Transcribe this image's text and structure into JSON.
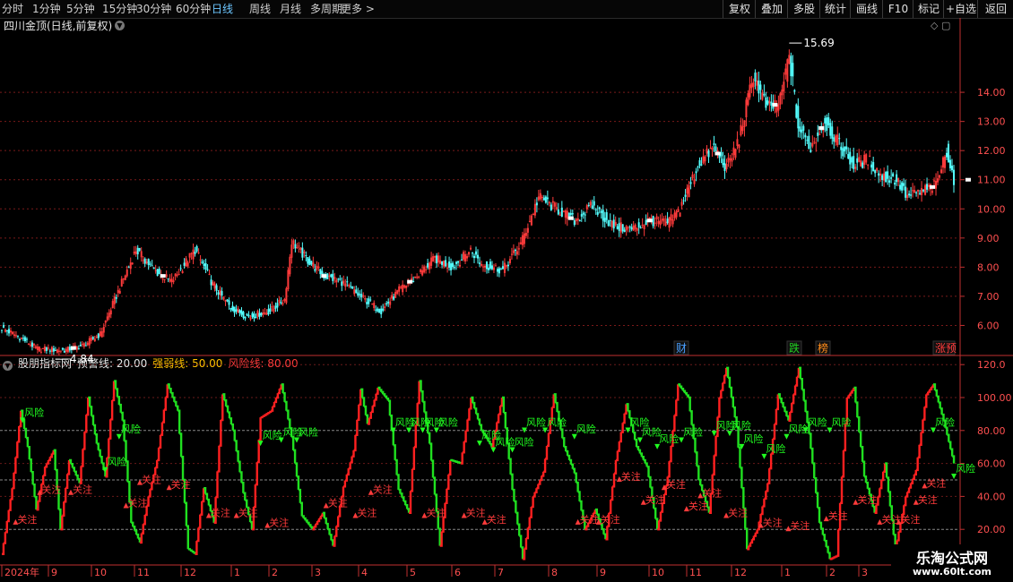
{
  "toolbar": {
    "periods": [
      {
        "label": "分时",
        "active": false
      },
      {
        "label": "1分钟",
        "active": false
      },
      {
        "label": "5分钟",
        "active": false
      },
      {
        "label": "15分钟",
        "active": false
      },
      {
        "label": "30分钟",
        "active": false
      },
      {
        "label": "60分钟",
        "active": false
      },
      {
        "label": "日线",
        "active": true
      },
      {
        "label": "周线",
        "active": false
      },
      {
        "label": "月线",
        "active": false
      },
      {
        "label": "多周期",
        "active": false
      },
      {
        "label": "更多 >",
        "active": false
      }
    ],
    "right_buttons": [
      "复权",
      "叠加",
      "多股",
      "统计",
      "画线",
      "F10",
      "标记",
      "+自选",
      "返回"
    ]
  },
  "stock_title": "四川金顶(日线,前复权)",
  "corner_tools": "◇ ▢",
  "indicator_header": {
    "name": "股朋指标网",
    "warn": "预警线: 20.00",
    "strong": "强弱线: 50.00",
    "risk": "风险线: 80.00"
  },
  "watermark": {
    "line1": "乐淘公式网",
    "line2": "www.60lt.com"
  },
  "colors": {
    "up": "#ff3b3b",
    "down": "#54ffff",
    "bg": "#000000",
    "axis": "#c03030",
    "ind_up": "#ff2020",
    "ind_down": "#20e020",
    "risk_label": "#20ff20",
    "attention_label": "#ff3b3b",
    "warn_text": "#ffff55",
    "strong_text": "#ff8c1a",
    "risk_text": "#ff3b3b"
  },
  "chart_data": [
    {
      "type": "candlestick",
      "title": "四川金顶(日线,前复权)",
      "ylim": [
        5.0,
        16.0
      ],
      "y_ticks": [
        6.0,
        7.0,
        8.0,
        9.0,
        10.0,
        11.0,
        12.0,
        13.0,
        14.0
      ],
      "y_tick_labels": [
        "6.00",
        "7.00",
        "8.00",
        "9.00",
        "10.00",
        "11.00",
        "12.00",
        "13.00",
        "14.00"
      ],
      "annotations": [
        {
          "text": "15.69",
          "price": 15.69
        },
        {
          "text": "4.84",
          "price": 4.84
        }
      ],
      "event_badges": [
        {
          "text": "财",
          "color": "#4aa0ff"
        },
        {
          "text": "跌",
          "color": "#20d020"
        },
        {
          "text": "榜",
          "color": "#ff8c1a"
        },
        {
          "text": "涨预",
          "color": "#ff3b3b"
        }
      ],
      "close_path": [
        [
          0,
          5.9
        ],
        [
          10,
          5.6
        ],
        [
          20,
          5.2
        ],
        [
          35,
          5.15
        ],
        [
          45,
          5.3
        ],
        [
          55,
          5.7
        ],
        [
          68,
          7.6
        ],
        [
          75,
          8.6
        ],
        [
          85,
          7.9
        ],
        [
          95,
          7.5
        ],
        [
          108,
          8.6
        ],
        [
          118,
          7.4
        ],
        [
          128,
          6.6
        ],
        [
          138,
          6.3
        ],
        [
          150,
          6.5
        ],
        [
          158,
          6.9
        ],
        [
          162,
          8.9
        ],
        [
          170,
          8.3
        ],
        [
          180,
          7.7
        ],
        [
          190,
          7.5
        ],
        [
          200,
          7.0
        ],
        [
          212,
          6.5
        ],
        [
          222,
          7.2
        ],
        [
          232,
          7.7
        ],
        [
          242,
          8.3
        ],
        [
          252,
          8.0
        ],
        [
          262,
          8.6
        ],
        [
          268,
          8.1
        ],
        [
          280,
          7.9
        ],
        [
          290,
          8.8
        ],
        [
          300,
          10.4
        ],
        [
          310,
          10.0
        ],
        [
          320,
          9.6
        ],
        [
          330,
          10.1
        ],
        [
          342,
          9.4
        ],
        [
          352,
          9.3
        ],
        [
          362,
          9.6
        ],
        [
          372,
          9.5
        ],
        [
          378,
          9.9
        ],
        [
          390,
          11.6
        ],
        [
          398,
          12.1
        ],
        [
          405,
          11.4
        ],
        [
          412,
          12.4
        ],
        [
          420,
          14.6
        ],
        [
          428,
          13.4
        ],
        [
          435,
          13.7
        ],
        [
          440,
          15.3
        ],
        [
          445,
          12.8
        ],
        [
          452,
          12.1
        ],
        [
          460,
          13.0
        ],
        [
          468,
          12.2
        ],
        [
          476,
          11.5
        ],
        [
          484,
          11.7
        ],
        [
          492,
          11.1
        ],
        [
          500,
          11.0
        ],
        [
          506,
          10.4
        ],
        [
          514,
          10.6
        ],
        [
          522,
          10.8
        ],
        [
          528,
          12.0
        ],
        [
          532,
          11.0
        ]
      ]
    },
    {
      "type": "line",
      "title": "股朋指标网",
      "ylim": [
        0,
        125
      ],
      "y_ticks": [
        20,
        40,
        60,
        80,
        100,
        120
      ],
      "y_tick_labels": [
        "20.00",
        "40.00",
        "60.00",
        "80.00",
        "100.00",
        "120.0"
      ],
      "reference_lines": [
        {
          "name": "预警线",
          "value": 20.0
        },
        {
          "name": "强弱线",
          "value": 50.0
        },
        {
          "name": "风险线",
          "value": 80.0
        }
      ],
      "signal_labels": {
        "risk": "风险",
        "attention": "关注"
      },
      "x_axis_labels": [
        "2024年",
        "9",
        "10",
        "11",
        "12",
        "1",
        "2",
        "3",
        "4",
        "5",
        "6",
        "7",
        "8",
        "9",
        "10",
        "11",
        "12",
        "1",
        "2",
        "3"
      ],
      "line_path": [
        [
          0,
          5
        ],
        [
          6,
          45
        ],
        [
          11,
          92
        ],
        [
          15,
          70
        ],
        [
          20,
          32
        ],
        [
          25,
          58
        ],
        [
          30,
          68
        ],
        [
          34,
          20
        ],
        [
          39,
          62
        ],
        [
          45,
          48
        ],
        [
          50,
          100
        ],
        [
          55,
          72
        ],
        [
          60,
          52
        ],
        [
          65,
          110
        ],
        [
          70,
          86
        ],
        [
          75,
          24
        ],
        [
          80,
          12
        ],
        [
          85,
          40
        ],
        [
          90,
          62
        ],
        [
          96,
          108
        ],
        [
          102,
          92
        ],
        [
          108,
          8
        ],
        [
          112,
          5
        ],
        [
          117,
          45
        ],
        [
          123,
          24
        ],
        [
          128,
          102
        ],
        [
          134,
          80
        ],
        [
          140,
          42
        ],
        [
          145,
          20
        ],
        [
          150,
          88
        ],
        [
          156,
          92
        ],
        [
          162,
          108
        ],
        [
          168,
          76
        ],
        [
          174,
          28
        ],
        [
          180,
          20
        ],
        [
          186,
          30
        ],
        [
          192,
          10
        ],
        [
          198,
          46
        ],
        [
          204,
          68
        ],
        [
          208,
          105
        ],
        [
          212,
          84
        ],
        [
          218,
          106
        ],
        [
          224,
          98
        ],
        [
          230,
          44
        ],
        [
          236,
          30
        ],
        [
          242,
          110
        ],
        [
          248,
          72
        ],
        [
          254,
          10
        ],
        [
          260,
          62
        ],
        [
          266,
          60
        ],
        [
          272,
          100
        ],
        [
          278,
          80
        ],
        [
          284,
          70
        ],
        [
          290,
          100
        ],
        [
          296,
          44
        ],
        [
          302,
          2
        ],
        [
          308,
          40
        ],
        [
          314,
          55
        ],
        [
          320,
          102
        ],
        [
          326,
          70
        ],
        [
          332,
          54
        ],
        [
          338,
          20
        ],
        [
          344,
          32
        ],
        [
          350,
          14
        ],
        [
          356,
          62
        ],
        [
          362,
          96
        ],
        [
          368,
          70
        ],
        [
          374,
          58
        ],
        [
          380,
          20
        ],
        [
          386,
          52
        ],
        [
          392,
          108
        ],
        [
          398,
          100
        ],
        [
          404,
          50
        ],
        [
          410,
          30
        ],
        [
          416,
          100
        ],
        [
          420,
          118
        ],
        [
          426,
          82
        ],
        [
          432,
          8
        ],
        [
          438,
          20
        ],
        [
          444,
          48
        ],
        [
          450,
          102
        ],
        [
          456,
          86
        ],
        [
          462,
          118
        ],
        [
          468,
          78
        ],
        [
          474,
          24
        ],
        [
          480,
          2
        ],
        [
          484,
          4
        ],
        [
          490,
          100
        ],
        [
          494,
          106
        ],
        [
          500,
          52
        ],
        [
          506,
          30
        ],
        [
          512,
          60
        ],
        [
          518,
          8
        ],
        [
          524,
          40
        ],
        [
          530,
          56
        ],
        [
          536,
          102
        ],
        [
          540,
          108
        ],
        [
          546,
          86
        ],
        [
          552,
          60
        ]
      ],
      "risk_signals": [
        [
          12,
          90
        ],
        [
          60,
          60
        ],
        [
          68,
          80
        ],
        [
          150,
          76
        ],
        [
          162,
          78
        ],
        [
          171,
          78
        ],
        [
          227,
          84
        ],
        [
          236,
          84
        ],
        [
          244,
          84
        ],
        [
          252,
          84
        ],
        [
          277,
          76
        ],
        [
          285,
          72
        ],
        [
          296,
          72
        ],
        [
          303,
          84
        ],
        [
          315,
          84
        ],
        [
          332,
          80
        ],
        [
          363,
          84
        ],
        [
          370,
          78
        ],
        [
          380,
          74
        ],
        [
          394,
          78
        ],
        [
          413,
          82
        ],
        [
          422,
          82
        ],
        [
          429,
          74
        ],
        [
          442,
          68
        ],
        [
          455,
          80
        ],
        [
          466,
          84
        ],
        [
          480,
          84
        ],
        [
          540,
          84
        ],
        [
          552,
          56
        ]
      ],
      "attention_signals": [
        [
          8,
          24
        ],
        [
          22,
          42
        ],
        [
          40,
          42
        ],
        [
          72,
          34
        ],
        [
          80,
          48
        ],
        [
          97,
          45
        ],
        [
          120,
          28
        ],
        [
          136,
          28
        ],
        [
          154,
          22
        ],
        [
          188,
          34
        ],
        [
          205,
          28
        ],
        [
          214,
          42
        ],
        [
          245,
          28
        ],
        [
          268,
          28
        ],
        [
          280,
          24
        ],
        [
          334,
          24
        ],
        [
          346,
          24
        ],
        [
          358,
          50
        ],
        [
          372,
          36
        ],
        [
          384,
          45
        ],
        [
          397,
          32
        ],
        [
          405,
          40
        ],
        [
          420,
          28
        ],
        [
          440,
          22
        ],
        [
          456,
          20
        ],
        [
          478,
          26
        ],
        [
          495,
          36
        ],
        [
          509,
          24
        ],
        [
          520,
          24
        ],
        [
          530,
          36
        ],
        [
          535,
          46
        ]
      ]
    }
  ]
}
